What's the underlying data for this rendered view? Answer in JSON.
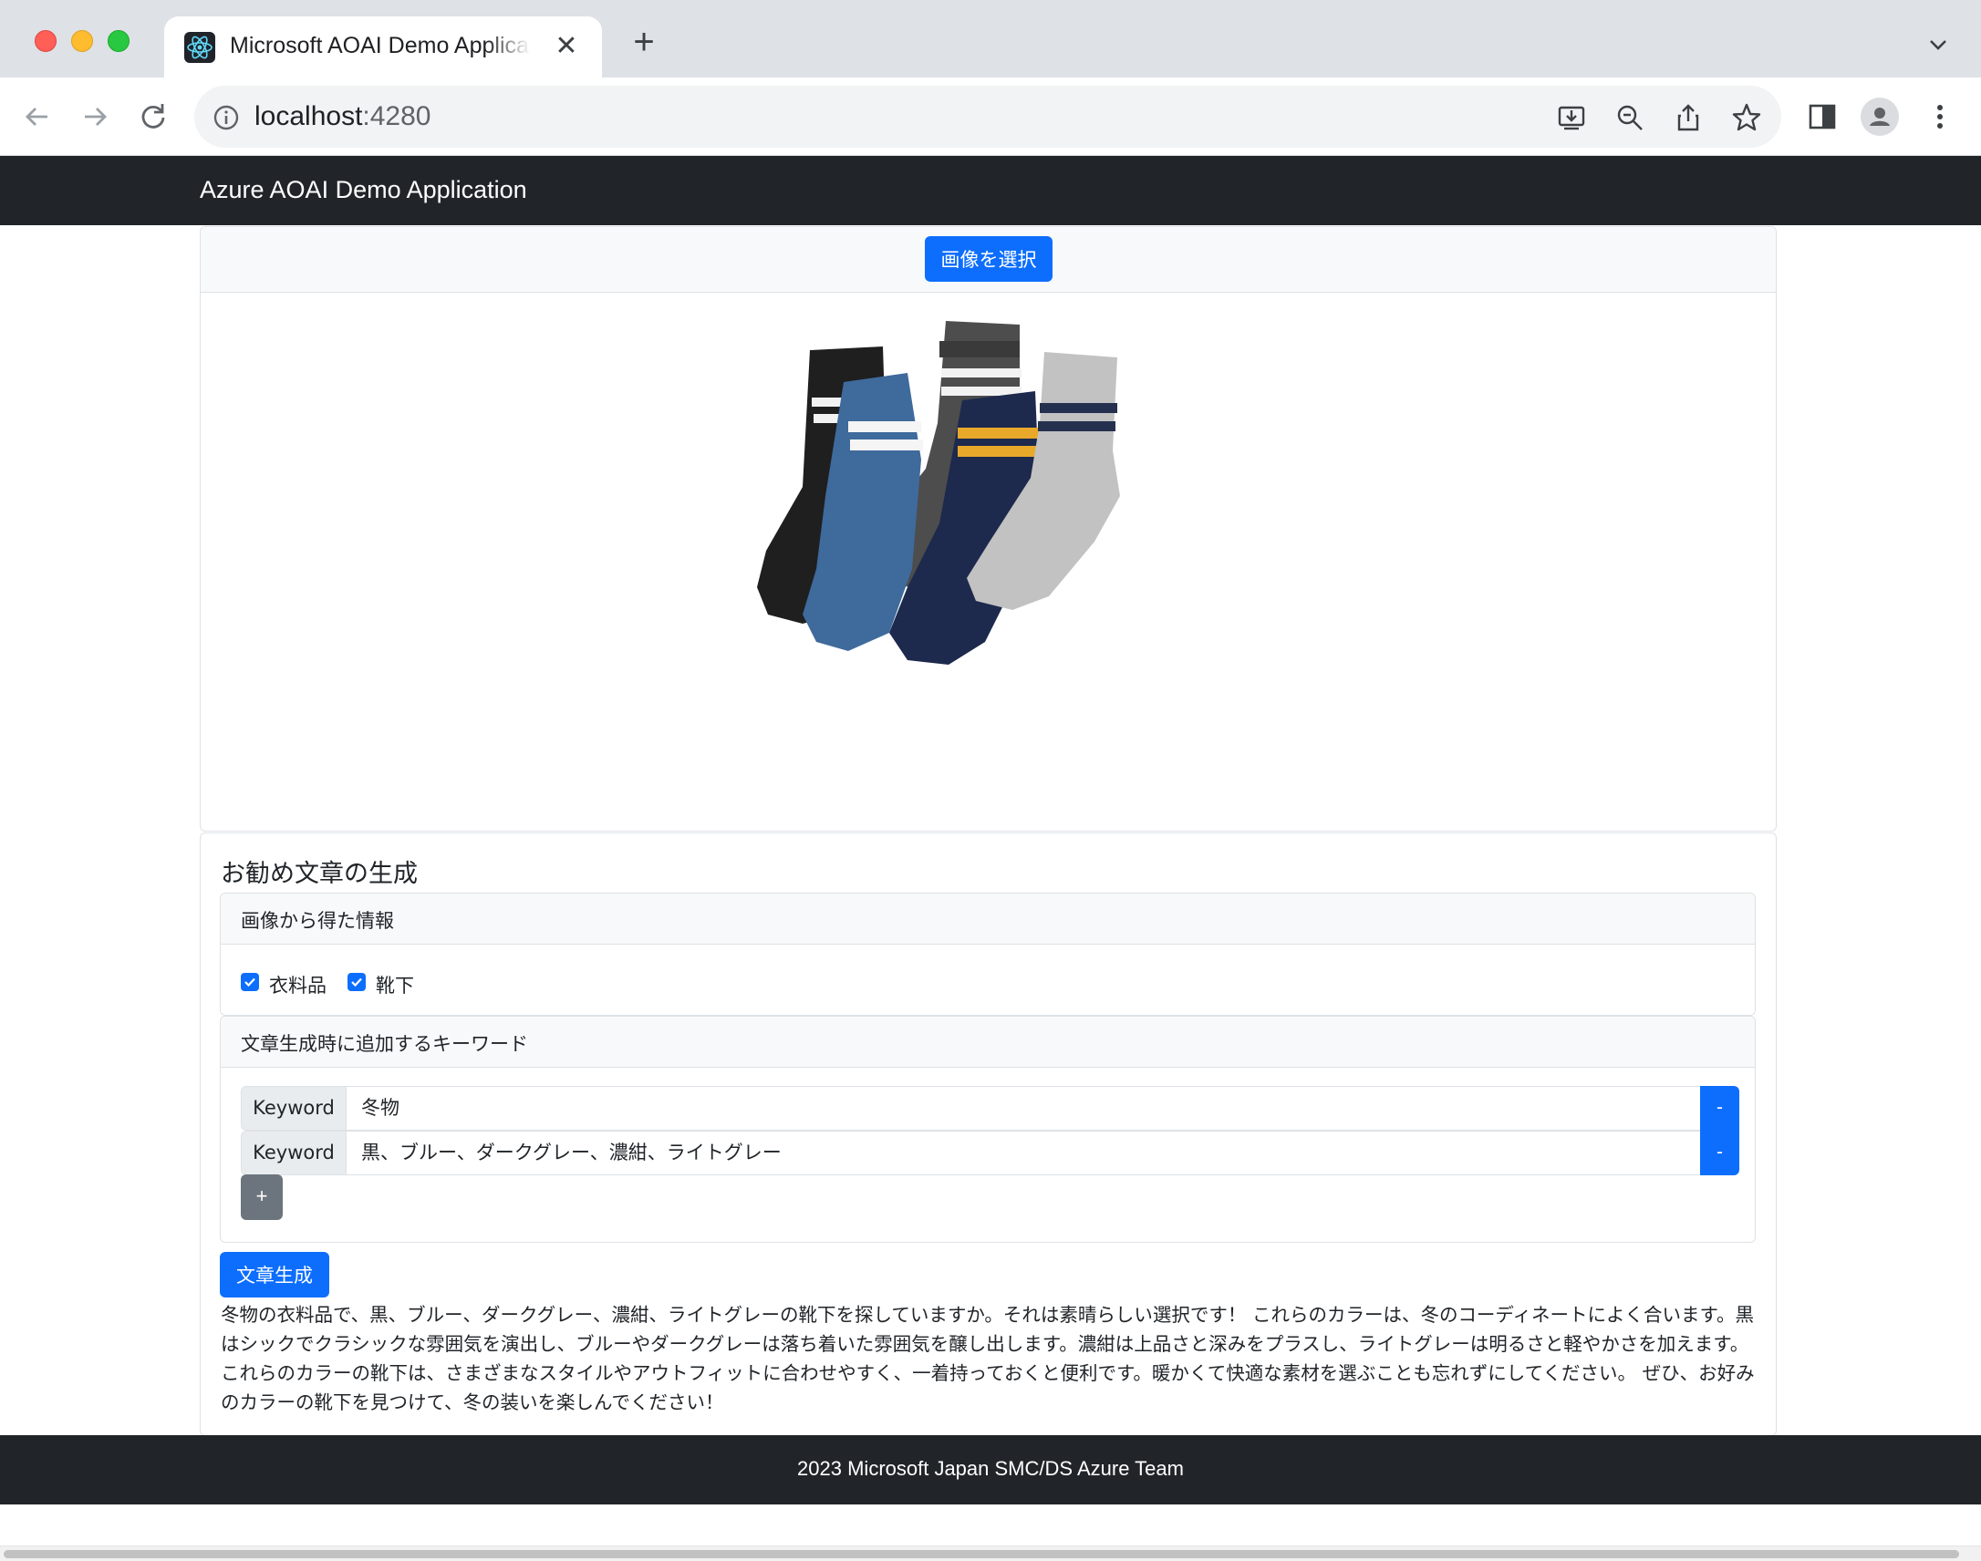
{
  "browser": {
    "tab_title": "Microsoft AOAI Demo Application",
    "tab_close_glyph": "✕",
    "new_tab_glyph": "+",
    "url_host": "localhost",
    "url_port": ":4280",
    "icons": [
      "back-icon",
      "forward-icon",
      "reload-icon",
      "info-icon",
      "install-app-icon",
      "zoom-icon",
      "share-icon",
      "bookmark-star-icon",
      "side-panel-icon",
      "profile-icon",
      "menu-kebab-icon",
      "tab-search-chevron-icon"
    ]
  },
  "app": {
    "brand": "Azure AOAI Demo Application"
  },
  "image_section": {
    "select_button": "画像を選択",
    "image_subject": "socks-photo"
  },
  "generation": {
    "title": "お勧め文章の生成",
    "info_header": "画像から得た情報",
    "tags": [
      {
        "label": "衣料品",
        "checked": true
      },
      {
        "label": "靴下",
        "checked": true
      }
    ],
    "keywords_header": "文章生成時に追加するキーワード",
    "keyword_label": "Keyword",
    "keywords": [
      "冬物",
      "黒、ブルー、ダークグレー、濃紺、ライトグレー"
    ],
    "remove_label": "-",
    "add_label": "+",
    "generate_button": "文章生成",
    "result": "冬物の衣料品で、黒、ブルー、ダークグレー、濃紺、ライトグレーの靴下を探していますか。それは素晴らしい選択です！ これらのカラーは、冬のコーディネートによく合います。黒はシックでクラシックな雰囲気を演出し、ブルーやダークグレーは落ち着いた雰囲気を醸し出します。濃紺は上品さと深みをプラスし、ライトグレーは明るさと軽やかさを加えます。 これらのカラーの靴下は、さまざまなスタイルやアウトフィットに合わせやすく、一着持っておくと便利です。暖かくて快適な素材を選ぶことも忘れずにしてください。 ぜひ、お好みのカラーの靴下を見つけて、冬の装いを楽しんでください！"
  },
  "footer": {
    "text": "2023 Microsoft Japan SMC/DS Azure Team"
  },
  "colors": {
    "primary": "#0d6efd",
    "secondary": "#6c757d",
    "navbar": "#212529"
  }
}
